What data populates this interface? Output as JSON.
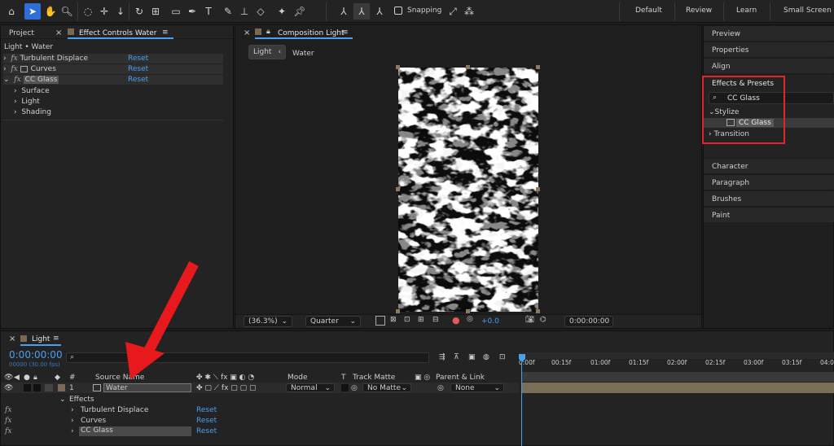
{
  "toolbar": {
    "snapping_label": "Snapping",
    "workspaces": [
      "Default",
      "Review",
      "Learn",
      "Small Screen"
    ]
  },
  "left_panel": {
    "tab_project": "Project",
    "tab_effect_controls": "Effect Controls Water",
    "breadcrumb": "Light • Water",
    "effects": [
      {
        "name": "Turbulent Displace",
        "reset": "Reset"
      },
      {
        "name": "Curves",
        "reset": "Reset"
      },
      {
        "name": "CC Glass",
        "reset": "Reset"
      }
    ],
    "subgroups": [
      "Surface",
      "Light",
      "Shading"
    ]
  },
  "composition": {
    "tab_title": "Composition Light",
    "nav_light": "Light",
    "nav_water": "Water",
    "zoom": "(36.3%)",
    "resolution": "Quarter",
    "exposure": "+0.0",
    "timecode": "0:00:00:00"
  },
  "right_panel": {
    "items_top": [
      "Preview",
      "Properties",
      "Align"
    ],
    "effects_presets_title": "Effects & Presets",
    "search_value": "CC Glass",
    "category": "Stylize",
    "result": "CC Glass",
    "category2": "Transition",
    "items_bottom": [
      "Character",
      "Paragraph",
      "Brushes",
      "Paint"
    ],
    "highlight_color": "#e0262a"
  },
  "timeline": {
    "tab_title": "Light",
    "timecode": "0:00:00:00",
    "frame_info": "00000 (30.00 fps)",
    "col_num": "#",
    "col_source": "Source Name",
    "col_mode": "Mode",
    "col_t": "T",
    "col_trackmatte": "Track Matte",
    "col_parent": "Parent & Link",
    "layer_num": "1",
    "layer_name": "Water",
    "layer_mode": "Normal",
    "layer_matte": "No Matte",
    "layer_parent": "None",
    "effects_label": "Effects",
    "effects": [
      {
        "name": "Turbulent Displace",
        "reset": "Reset"
      },
      {
        "name": "Curves",
        "reset": "Reset"
      },
      {
        "name": "CC Glass",
        "reset": "Reset"
      }
    ],
    "ruler_labels": [
      "0:00f",
      "00:15f",
      "01:00f",
      "01:15f",
      "02:00f",
      "02:15f",
      "03:00f",
      "03:15f",
      "04:0"
    ],
    "arrow_color": "#e8191d"
  }
}
